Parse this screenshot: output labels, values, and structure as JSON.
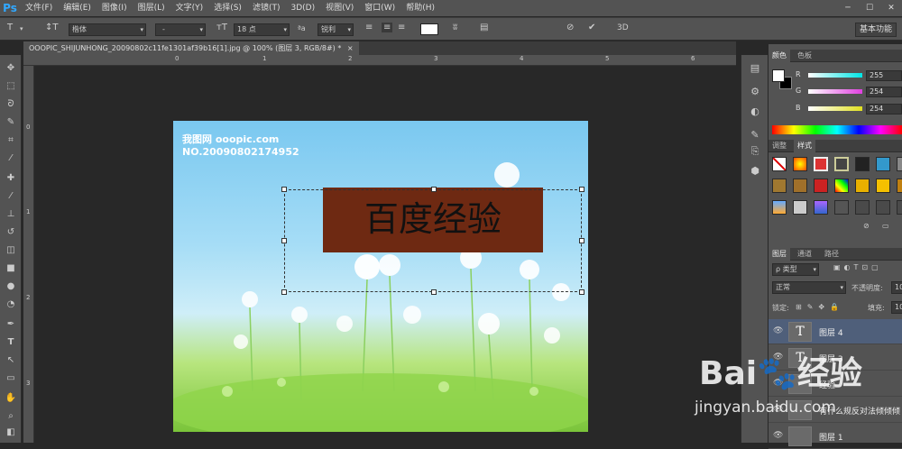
{
  "app": {
    "logo": "Ps"
  },
  "menus": [
    "文件(F)",
    "编辑(E)",
    "图像(I)",
    "图层(L)",
    "文字(Y)",
    "选择(S)",
    "滤镜(T)",
    "3D(D)",
    "视图(V)",
    "窗口(W)",
    "帮助(H)"
  ],
  "window_controls": {
    "minimize": "─",
    "maximize": "☐",
    "close": "✕"
  },
  "options": {
    "font_family": "楷体",
    "font_style": "-",
    "font_size": "18 点",
    "aa_label": "ªa",
    "aa_mode": "锐利",
    "workspace": "基本功能",
    "threed": "3D"
  },
  "doc_tab": {
    "title": "OOOPIC_SHIJUNHONG_20090802c11fe1301af39b16[1].jpg @ 100% (图层 3, RGB/8#) *",
    "close": "×"
  },
  "ruler": {
    "h": [
      "0",
      "1",
      "2",
      "3",
      "4",
      "5",
      "6",
      "7"
    ],
    "v": [
      "0",
      "1",
      "2",
      "3"
    ]
  },
  "canvas": {
    "watermark_site": "我图网 ooopic.com",
    "watermark_no": "NO.20090802174952",
    "main_text": "百度经验"
  },
  "color_panel": {
    "tabs": [
      "颜色",
      "色板"
    ],
    "r_label": "R",
    "r_value": "255",
    "g_label": "G",
    "g_value": "254",
    "b_label": "B",
    "b_value": "254",
    "r_color": "#00e5e5",
    "g_color": "#e040e0",
    "b_color": "#e0e020"
  },
  "styles_panel": {
    "tabs": [
      "调整",
      "样式"
    ]
  },
  "layers_panel": {
    "tabs": [
      "图层",
      "通道",
      "路径"
    ],
    "filter_label": "ρ 类型",
    "blend_mode": "正常",
    "opacity_label": "不透明度:",
    "opacity_value": "100",
    "lock_label": "锁定:",
    "fill_label": "填充:",
    "fill_value": "100",
    "layers": [
      {
        "name": "图层 4",
        "thumb": "T"
      },
      {
        "name": "图层 3",
        "thumb": "T"
      },
      {
        "name": "经验",
        "thumb": ""
      },
      {
        "name": "有什么规反对法倾倾倾",
        "thumb": ""
      },
      {
        "name": "图层 1",
        "thumb": ""
      }
    ]
  },
  "overlay": {
    "baidu_logo": "Bai🐾经验",
    "baidu_url": "jingyan.baidu.com"
  }
}
